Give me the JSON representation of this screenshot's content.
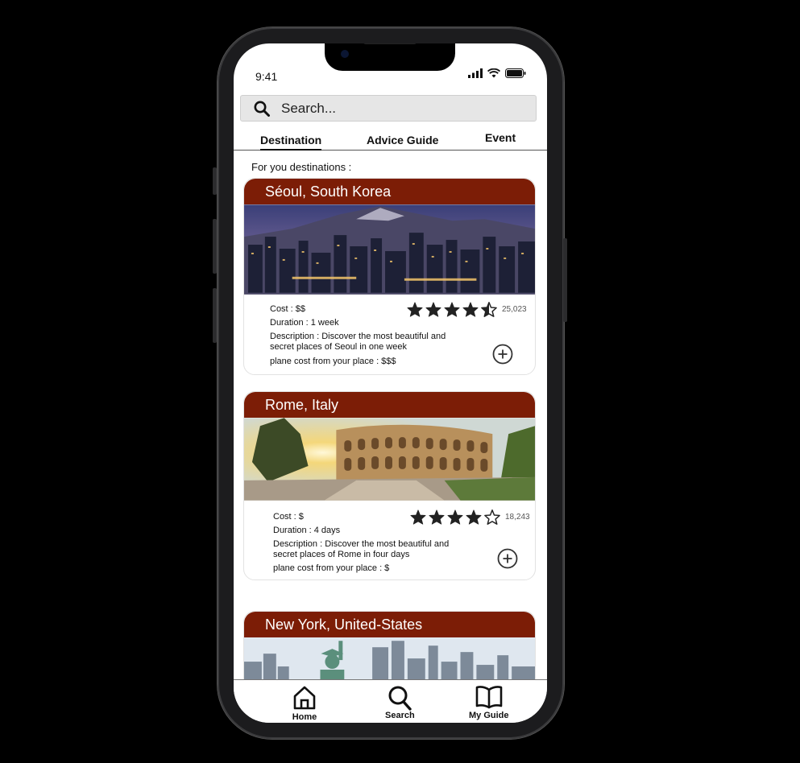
{
  "status": {
    "time": "9:41"
  },
  "search": {
    "placeholder": "Search..."
  },
  "tabs": [
    {
      "label": "Destination",
      "active": true
    },
    {
      "label": "Advice Guide",
      "active": false
    },
    {
      "label": "Event",
      "active": false
    }
  ],
  "section_label": "For you destinations :",
  "cards": [
    {
      "title": "Séoul,  South Korea",
      "cost": "Cost : $$",
      "duration": "Duration : 1 week",
      "description": "Description : Discover the most beautiful and secret places of Seoul in one week",
      "plane_cost": "plane cost from your place : $$$",
      "rating": 4.5,
      "reviews": "25,023"
    },
    {
      "title": "Rome, Italy",
      "cost": "Cost : $",
      "duration": "Duration : 4 days",
      "description": "Description : Discover the most beautiful and secret places of Rome in four days",
      "plane_cost": "plane cost from your place : $",
      "rating": 4,
      "reviews": "18,243"
    },
    {
      "title": "New York, United-States"
    }
  ],
  "bottom_nav": [
    {
      "label": "Home",
      "icon": "home-icon"
    },
    {
      "label": "Search",
      "icon": "search-icon"
    },
    {
      "label": "My Guide",
      "icon": "book-icon"
    }
  ],
  "colors": {
    "card_header": "#7c1d06",
    "background": "#000000",
    "search_bg": "#e6e6e6"
  }
}
